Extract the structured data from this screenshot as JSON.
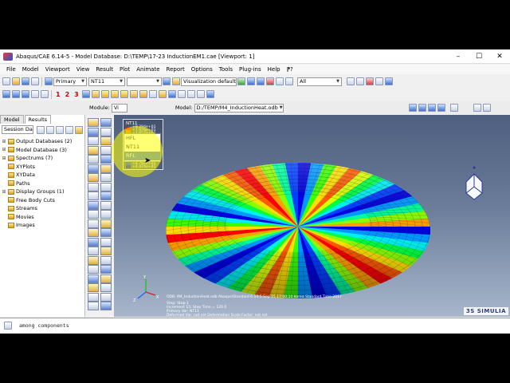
{
  "window": {
    "title": "Abaqus/CAE 6.14-5 - Model Database: D:\\TEMP\\17-23 InductionEM1.cae [Viewport: 1]",
    "min": "–",
    "max": "☐",
    "close": "✕"
  },
  "menu": [
    "File",
    "Model",
    "Viewport",
    "View",
    "Result",
    "Plot",
    "Animate",
    "Report",
    "Options",
    "Tools",
    "Plug-ins",
    "Help",
    "⁋?"
  ],
  "toolbar1": {
    "primary": "Primary",
    "variable": "NT11",
    "vis_defaults": "Visualization defaults",
    "filter": "All"
  },
  "toolbar2": {
    "numbers": [
      "1",
      "2",
      "3"
    ]
  },
  "context": {
    "module_label": "Module:",
    "module_value": "Vi",
    "model_label": "Model:",
    "model_value": "D:/TEMP/M4_InductionHeat.odb"
  },
  "dropdown_options": [
    "HFL",
    "NT11",
    "RFL"
  ],
  "dropdown_selected": "RFL",
  "left": {
    "tabs": [
      "Model",
      "Results"
    ],
    "session": "Session Data",
    "tree": [
      {
        "label": "Output Databases (2)",
        "exp": "⊞"
      },
      {
        "label": "Model Database (3)",
        "exp": "⊞"
      },
      {
        "label": "Spectrums (7)",
        "exp": "⊞"
      },
      {
        "label": "XYPlots",
        "exp": ""
      },
      {
        "label": "XYData",
        "exp": ""
      },
      {
        "label": "Paths",
        "exp": ""
      },
      {
        "label": "Display Groups (1)",
        "exp": "⊞"
      },
      {
        "label": "Free Body Cuts",
        "exp": ""
      },
      {
        "label": "Streams",
        "exp": ""
      },
      {
        "label": "Movies",
        "exp": ""
      },
      {
        "label": "Images",
        "exp": ""
      }
    ]
  },
  "legend": {
    "title": "NT11",
    "values": [
      "+8.294e+01",
      "+7.976e+01",
      "+7.657e+01",
      "+7.339e+01",
      "+7.021e+01",
      "+6.702e+01",
      "+6.384e+01",
      "+6.066e+01",
      "+5.747e+01",
      "+5.429e+01",
      "+5.111e+01",
      "+4.792e+01",
      "+4.474e+01"
    ],
    "colors": [
      "#ff0000",
      "#ff5a00",
      "#ffa000",
      "#ffdf00",
      "#d8ff00",
      "#8cff00",
      "#3cff00",
      "#00ff40",
      "#00ff9a",
      "#00f0f0",
      "#0098ff",
      "#0040ff",
      "#0000e0"
    ]
  },
  "viewport_info": {
    "odb": "ODB: M4_InductionHeat.odb    Abaqus/Standard 6.14-5    Sep 15 17:00:10 Korea Standard Time 2017",
    "lines": [
      "Step: Step-1",
      "Increment    15: Step Time =    120.0",
      "Primary Var: NT11",
      "Deformed Var: not set   Deformation Scale Factor: not set"
    ]
  },
  "message": "among components",
  "brand": "3S SIMULIA",
  "triad": {
    "x": "X",
    "y": "Y",
    "z": "Z"
  }
}
